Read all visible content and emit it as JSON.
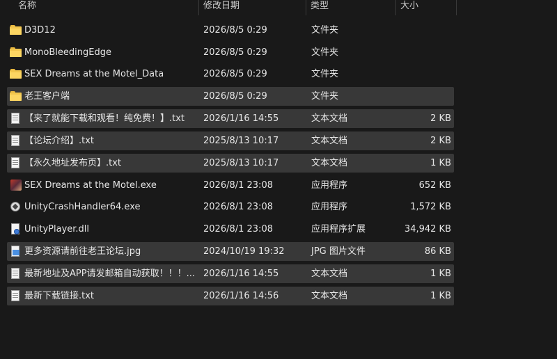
{
  "columns": {
    "name": "名称",
    "date": "修改日期",
    "type": "类型",
    "size": "大小"
  },
  "files": [
    {
      "icon": "folder-icon",
      "name": "D3D12",
      "date": "2026/8/5 0:29",
      "type": "文件夹",
      "size": "",
      "selected": false
    },
    {
      "icon": "folder-icon",
      "name": "MonoBleedingEdge",
      "date": "2026/8/5 0:29",
      "type": "文件夹",
      "size": "",
      "selected": false
    },
    {
      "icon": "folder-icon",
      "name": "SEX Dreams at the Motel_Data",
      "date": "2026/8/5 0:29",
      "type": "文件夹",
      "size": "",
      "selected": false
    },
    {
      "icon": "folder-icon",
      "name": "老王客户端",
      "date": "2026/8/5 0:29",
      "type": "文件夹",
      "size": "",
      "selected": true
    },
    {
      "icon": "text-file-icon",
      "name": "【来了就能下载和观看！纯免费！】.txt",
      "date": "2026/1/16 14:55",
      "type": "文本文档",
      "size": "2 KB",
      "selected": true
    },
    {
      "icon": "text-file-icon",
      "name": "【论坛介绍】.txt",
      "date": "2025/8/13 10:17",
      "type": "文本文档",
      "size": "2 KB",
      "selected": true
    },
    {
      "icon": "text-file-icon",
      "name": "【永久地址发布页】.txt",
      "date": "2025/8/13 10:17",
      "type": "文本文档",
      "size": "1 KB",
      "selected": true
    },
    {
      "icon": "game-exe-icon",
      "name": "SEX Dreams at the Motel.exe",
      "date": "2026/8/1 23:08",
      "type": "应用程序",
      "size": "652 KB",
      "selected": false
    },
    {
      "icon": "unity-icon",
      "name": "UnityCrashHandler64.exe",
      "date": "2026/8/1 23:08",
      "type": "应用程序",
      "size": "1,572 KB",
      "selected": false
    },
    {
      "icon": "dll-icon",
      "name": "UnityPlayer.dll",
      "date": "2026/8/1 23:08",
      "type": "应用程序扩展",
      "size": "34,942 KB",
      "selected": false
    },
    {
      "icon": "jpg-icon",
      "name": "更多资源请前往老王论坛.jpg",
      "date": "2024/10/19 19:32",
      "type": "JPG 图片文件",
      "size": "86 KB",
      "selected": true
    },
    {
      "icon": "text-file-icon",
      "name": "最新地址及APP请发邮箱自动获取！！！...",
      "date": "2026/1/16 14:55",
      "type": "文本文档",
      "size": "1 KB",
      "selected": true
    },
    {
      "icon": "text-file-icon",
      "name": "最新下载链接.txt",
      "date": "2026/1/16 14:56",
      "type": "文本文档",
      "size": "1 KB",
      "selected": true
    }
  ]
}
